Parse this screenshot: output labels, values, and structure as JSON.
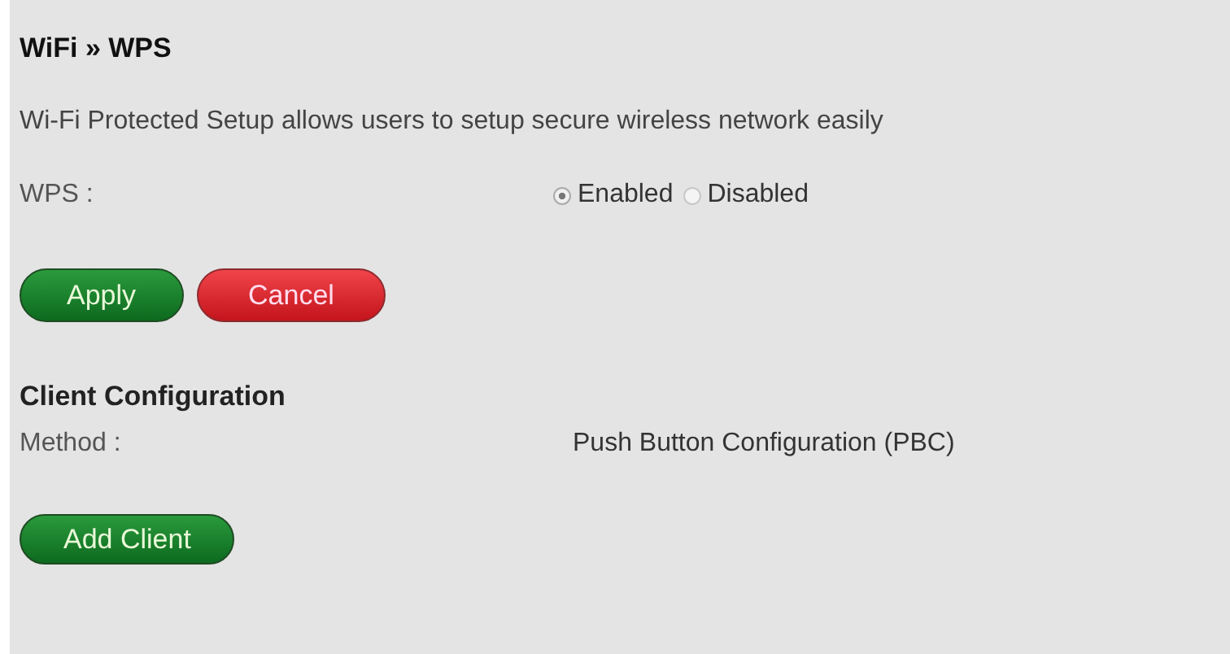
{
  "title": "WiFi » WPS",
  "description": "Wi-Fi Protected Setup allows users to setup secure wireless network easily",
  "wps": {
    "label": "WPS :",
    "options": [
      {
        "label": "Enabled",
        "selected": true
      },
      {
        "label": "Disabled",
        "selected": false
      }
    ]
  },
  "buttons": [
    {
      "label": "Apply",
      "kind": "primary"
    },
    {
      "label": "Cancel",
      "kind": "danger"
    }
  ],
  "client_configuration": {
    "heading": "Client Configuration",
    "method_label": "Method :",
    "method_value": "Push Button Configuration (PBC)",
    "button": {
      "label": "Add Client",
      "kind": "primary"
    }
  }
}
